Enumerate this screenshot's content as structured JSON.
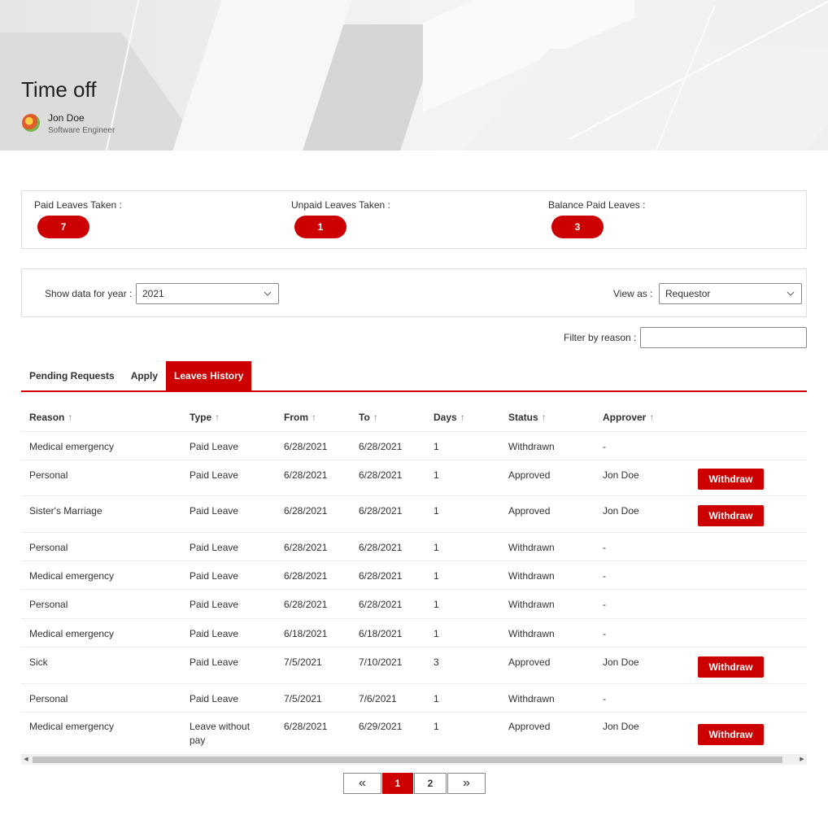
{
  "header": {
    "title": "Time off",
    "user_name": "Jon Doe",
    "user_role": "Software Engineer"
  },
  "summary": {
    "paid_taken_label": "Paid Leaves Taken :",
    "paid_taken_value": "7",
    "unpaid_taken_label": "Unpaid Leaves Taken :",
    "unpaid_taken_value": "1",
    "balance_label": "Balance Paid Leaves :",
    "balance_value": "3"
  },
  "filters": {
    "year_label": "Show data for year :",
    "year_value": "2021",
    "view_label": "View as :",
    "view_value": "Requestor",
    "reason_label": "Filter by reason :",
    "reason_value": ""
  },
  "tabs": [
    {
      "label": "Pending Requests",
      "active": false
    },
    {
      "label": "Apply",
      "active": false
    },
    {
      "label": "Leaves History",
      "active": true
    }
  ],
  "table": {
    "columns": [
      "Reason",
      "Type",
      "From",
      "To",
      "Days",
      "Status",
      "Approver"
    ],
    "sort_glyph": "↑",
    "withdraw_label": "Withdraw",
    "rows": [
      {
        "reason": "Medical emergency",
        "type": "Paid Leave",
        "from": "6/28/2021",
        "to": "6/28/2021",
        "days": "1",
        "status": "Withdrawn",
        "approver": "-",
        "withdraw": false
      },
      {
        "reason": "Personal",
        "type": "Paid Leave",
        "from": "6/28/2021",
        "to": "6/28/2021",
        "days": "1",
        "status": "Approved",
        "approver": "Jon Doe",
        "withdraw": true
      },
      {
        "reason": "Sister's Marriage",
        "type": "Paid Leave",
        "from": "6/28/2021",
        "to": "6/28/2021",
        "days": "1",
        "status": "Approved",
        "approver": "Jon Doe",
        "withdraw": true
      },
      {
        "reason": "Personal",
        "type": "Paid Leave",
        "from": "6/28/2021",
        "to": "6/28/2021",
        "days": "1",
        "status": "Withdrawn",
        "approver": "-",
        "withdraw": false
      },
      {
        "reason": "Medical emergency",
        "type": "Paid Leave",
        "from": "6/28/2021",
        "to": "6/28/2021",
        "days": "1",
        "status": "Withdrawn",
        "approver": "-",
        "withdraw": false
      },
      {
        "reason": "Personal",
        "type": "Paid Leave",
        "from": "6/28/2021",
        "to": "6/28/2021",
        "days": "1",
        "status": "Withdrawn",
        "approver": "-",
        "withdraw": false
      },
      {
        "reason": "Medical emergency",
        "type": "Paid Leave",
        "from": "6/18/2021",
        "to": "6/18/2021",
        "days": "1",
        "status": "Withdrawn",
        "approver": "-",
        "withdraw": false
      },
      {
        "reason": "Sick",
        "type": "Paid Leave",
        "from": "7/5/2021",
        "to": "7/10/2021",
        "days": "3",
        "status": "Approved",
        "approver": "Jon Doe",
        "withdraw": true
      },
      {
        "reason": "Personal",
        "type": "Paid Leave",
        "from": "7/5/2021",
        "to": "7/6/2021",
        "days": "1",
        "status": "Withdrawn",
        "approver": "-",
        "withdraw": false
      },
      {
        "reason": "Medical emergency",
        "type": "Leave without pay",
        "from": "6/28/2021",
        "to": "6/29/2021",
        "days": "1",
        "status": "Approved",
        "approver": "Jon Doe",
        "withdraw": true
      }
    ]
  },
  "pagination": {
    "first_glyph": "«",
    "next_glyph": "»",
    "pages": [
      "1",
      "2"
    ],
    "current": "1"
  },
  "colors": {
    "accent": "#cc0000"
  }
}
